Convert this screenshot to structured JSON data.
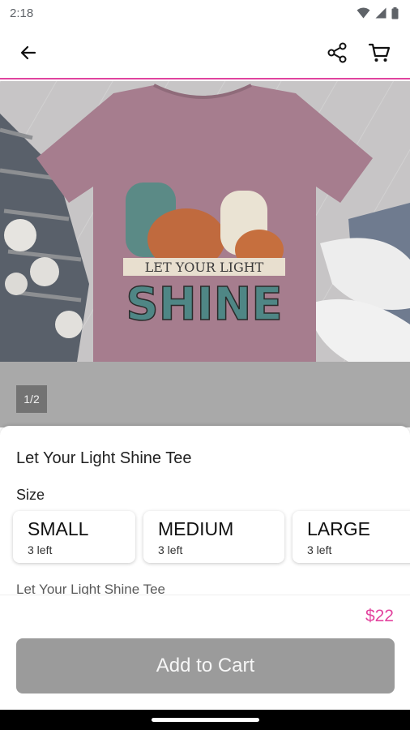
{
  "status": {
    "time": "2:18"
  },
  "gallery": {
    "page_indicator": "1/2"
  },
  "product": {
    "title": "Let Your Light Shine Tee",
    "size_label": "Size",
    "sizes": [
      {
        "name": "SMALL",
        "stock": "3 left"
      },
      {
        "name": "MEDIUM",
        "stock": "3 left"
      },
      {
        "name": "LARGE",
        "stock": "3 left"
      }
    ],
    "description_preview": "Let Your Light Shine Tee",
    "price": "$22"
  },
  "actions": {
    "add_to_cart": "Add to Cart"
  },
  "colors": {
    "accent": "#e3449f",
    "button": "#9b9b9b"
  }
}
